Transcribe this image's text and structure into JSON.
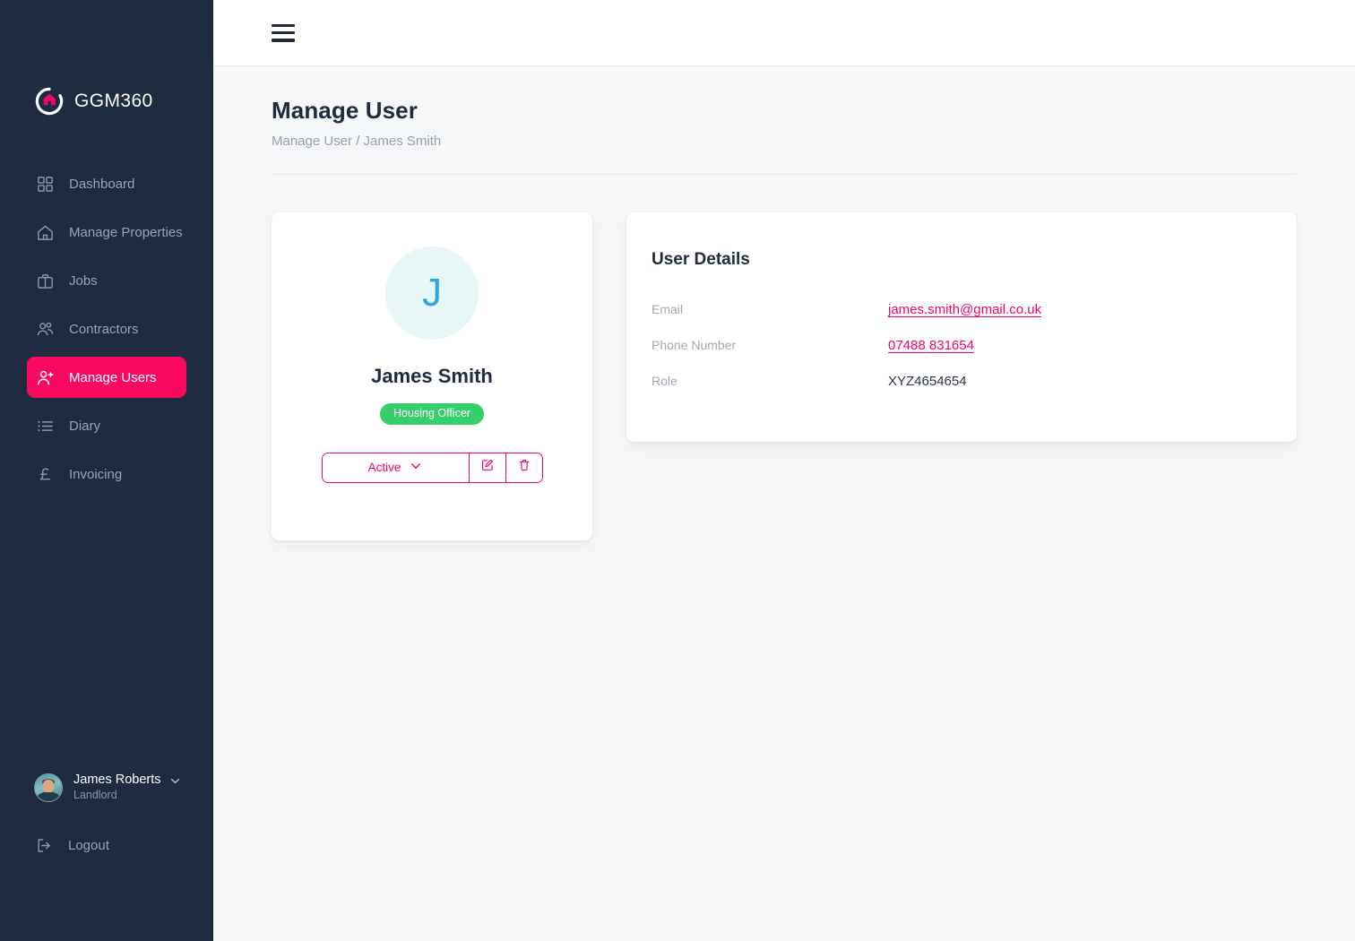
{
  "app": {
    "brand_name": "GGM360",
    "logo_icon": "ggm360-circle-house-logo"
  },
  "sidebar": {
    "items": [
      {
        "label": "Dashboard",
        "icon": "grid-icon",
        "active": false
      },
      {
        "label": "Manage Properties",
        "icon": "house-icon",
        "active": false
      },
      {
        "label": "Jobs",
        "icon": "briefcase-icon",
        "active": false
      },
      {
        "label": "Contractors",
        "icon": "users-icon",
        "active": false
      },
      {
        "label": "Manage Users",
        "icon": "user-plus-icon",
        "active": true
      },
      {
        "label": "Diary",
        "icon": "list-icon",
        "active": false
      },
      {
        "label": "Invoicing",
        "icon": "pound-icon",
        "active": false
      }
    ],
    "profile": {
      "name": "James Roberts",
      "role": "Landlord",
      "avatar_icon": "user-photo-avatar",
      "chevron_icon": "chevron-down-icon"
    },
    "logout": {
      "label": "Logout",
      "icon": "logout-icon"
    }
  },
  "topbar": {
    "menu_icon": "hamburger-menu-icon"
  },
  "page": {
    "title": "Manage User",
    "breadcrumb": "Manage User / James Smith"
  },
  "profile_card": {
    "initial": "J",
    "name": "James Smith",
    "role_badge": "Housing Officer",
    "status": "Active",
    "status_chevron_icon": "chevron-down-icon",
    "edit_icon": "edit-pencil-icon",
    "delete_icon": "trash-icon"
  },
  "details": {
    "title": "User Details",
    "rows": [
      {
        "label": "Email",
        "value": "james.smith@gmail.co.uk",
        "link": true
      },
      {
        "label": "Phone Number",
        "value": "07488 831654",
        "link": true
      },
      {
        "label": "Role",
        "value": "XYZ4654654",
        "link": false
      }
    ]
  },
  "colors": {
    "sidebar_bg": "#1e2b40",
    "accent_pink": "#fa0a5f",
    "link_pink": "#f2056a",
    "badge_green": "#36cf6b",
    "avatar_blue": "#2ba7e0",
    "page_bg": "#f6f7f9"
  }
}
